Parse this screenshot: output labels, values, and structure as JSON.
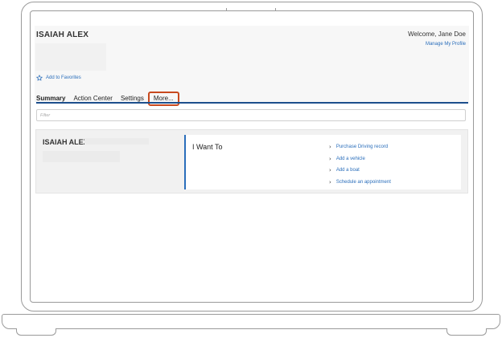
{
  "header": {
    "user_name": "ISAIAH ALEX",
    "welcome_text": "Welcome, Jane Doe",
    "manage_profile": "Manage My Profile",
    "favorites_label": "Add to Favorites"
  },
  "tabs": [
    {
      "label": "Summary",
      "active": true
    },
    {
      "label": "Action Center",
      "active": false
    },
    {
      "label": "Settings",
      "active": false
    },
    {
      "label": "More...",
      "active": false,
      "highlighted": true
    }
  ],
  "filter": {
    "placeholder": "Filter",
    "value": ""
  },
  "summary": {
    "name": "ISAIAH ALEX",
    "i_want_to": {
      "title": "I Want To",
      "items": [
        "Purchase Driving record",
        "Add a vehicle",
        "Add a boat",
        "Schedule an appointment"
      ]
    }
  },
  "colors": {
    "accent_blue": "#2a6ebb",
    "tab_rule": "#1d4f8c",
    "highlight_box": "#c8491e"
  },
  "icons": {
    "favorites": "star-outline-icon",
    "list_item": "chevron-right-icon"
  }
}
